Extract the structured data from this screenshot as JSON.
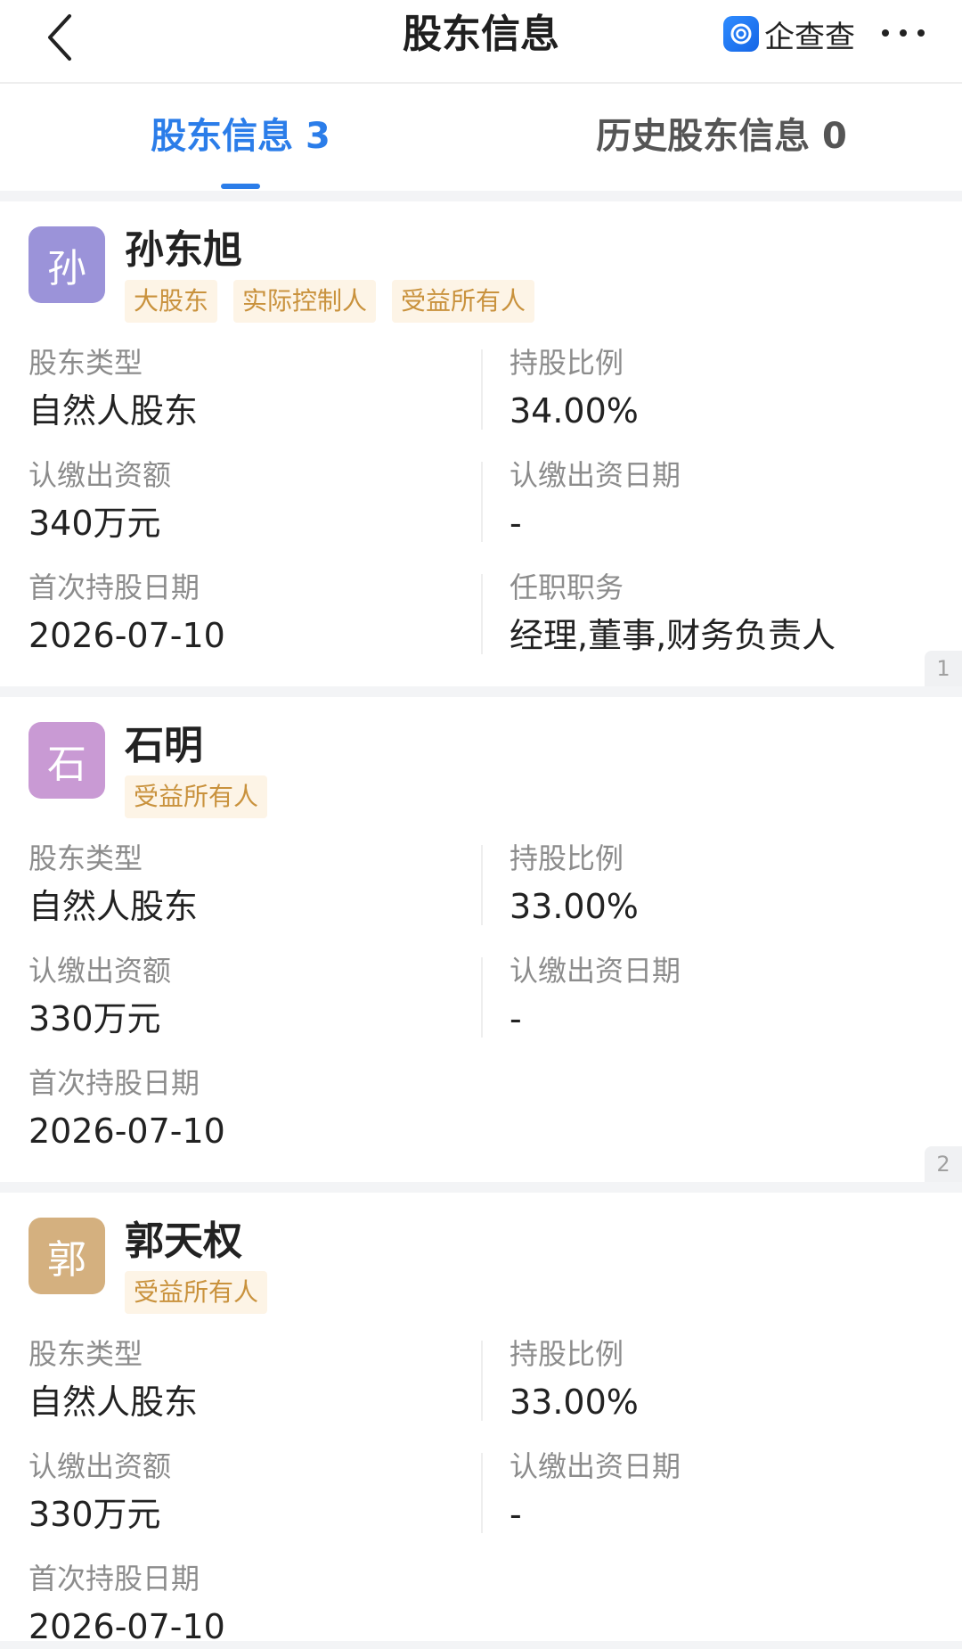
{
  "header": {
    "title": "股东信息",
    "brand_name": "企查查"
  },
  "tabs": [
    {
      "label": "股东信息 3",
      "active": true
    },
    {
      "label": "历史股东信息 0",
      "active": false
    }
  ],
  "shareholders": [
    {
      "avatar_char": "孙",
      "avatar_color": "#9b93d9",
      "name": "孙东旭",
      "tags": [
        "大股东",
        "实际控制人",
        "受益所有人"
      ],
      "type_label": "股东类型",
      "type_value": "自然人股东",
      "ratio_label": "持股比例",
      "ratio_value": "34.00%",
      "amount_label": "认缴出资额",
      "amount_value": "340万元",
      "date_label": "认缴出资日期",
      "date_value": "-",
      "first_label": "首次持股日期",
      "first_value": "2026-07-10",
      "role_label": "任职职务",
      "role_value": "经理,董事,财务负责人",
      "index": "1"
    },
    {
      "avatar_char": "石",
      "avatar_color": "#c99ad4",
      "name": "石明",
      "tags": [
        "受益所有人"
      ],
      "type_label": "股东类型",
      "type_value": "自然人股东",
      "ratio_label": "持股比例",
      "ratio_value": "33.00%",
      "amount_label": "认缴出资额",
      "amount_value": "330万元",
      "date_label": "认缴出资日期",
      "date_value": "-",
      "first_label": "首次持股日期",
      "first_value": "2026-07-10",
      "index": "2"
    },
    {
      "avatar_char": "郭",
      "avatar_color": "#d4b07f",
      "name": "郭天权",
      "tags": [
        "受益所有人"
      ],
      "type_label": "股东类型",
      "type_value": "自然人股东",
      "ratio_label": "持股比例",
      "ratio_value": "33.00%",
      "amount_label": "认缴出资额",
      "amount_value": "330万元",
      "date_label": "认缴出资日期",
      "date_value": "-",
      "first_label": "首次持股日期",
      "first_value": "2026-07-10"
    }
  ],
  "colors": {
    "accent": "#2b7de9",
    "tag_bg": "#fdf4e6",
    "tag_text": "#c9923d"
  }
}
